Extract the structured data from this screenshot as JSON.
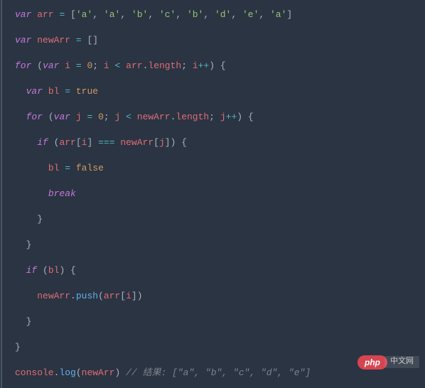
{
  "code": {
    "l1": {
      "kw": "var",
      "sp1": " ",
      "v": "arr",
      "sp2": " ",
      "eq": "=",
      "sp3": " ",
      "ob": "[",
      "s1": "'a'",
      "c1": ", ",
      "s2": "'a'",
      "c2": ", ",
      "s3": "'b'",
      "c3": ", ",
      "s4": "'c'",
      "c4": ", ",
      "s5": "'b'",
      "c5": ", ",
      "s6": "'d'",
      "c6": ", ",
      "s7": "'e'",
      "c7": ", ",
      "s8": "'a'",
      "cb": "]"
    },
    "l2": {
      "kw": "var",
      "sp1": " ",
      "v": "newArr",
      "sp2": " ",
      "eq": "=",
      "sp3": " ",
      "ob": "[",
      "cb": "]"
    },
    "l3": {
      "kw1": "for",
      "sp1": " ",
      "op": "(",
      "kw2": "var",
      "sp2": " ",
      "v": "i",
      "sp3": " ",
      "eq": "=",
      "sp4": " ",
      "n": "0",
      "sc1": "; ",
      "v2": "i",
      "sp5": " ",
      "lt": "<",
      "sp6": " ",
      "arr": "arr",
      "dot": ".",
      "len": "length",
      "sc2": "; ",
      "v3": "i",
      "inc": "++",
      "cp": ") {"
    },
    "l4": {
      "ind": "  ",
      "kw": "var",
      "sp1": " ",
      "v": "bl",
      "sp2": " ",
      "eq": "=",
      "sp3": " ",
      "b": "true"
    },
    "l5": {
      "ind": "  ",
      "kw1": "for",
      "sp1": " ",
      "op": "(",
      "kw2": "var",
      "sp2": " ",
      "v": "j",
      "sp3": " ",
      "eq": "=",
      "sp4": " ",
      "n": "0",
      "sc1": "; ",
      "v2": "j",
      "sp5": " ",
      "lt": "<",
      "sp6": " ",
      "na": "newArr",
      "dot": ".",
      "len": "length",
      "sc2": "; ",
      "v3": "j",
      "inc": "++",
      "cp": ") {"
    },
    "l6": {
      "ind": "    ",
      "kw": "if",
      "sp1": " ",
      "op": "(",
      "arr": "arr",
      "ob1": "[",
      "i": "i",
      "cb1": "]",
      "sp2": " ",
      "eqq": "===",
      "sp3": " ",
      "na": "newArr",
      "ob2": "[",
      "j": "j",
      "cb2": "]",
      "cp": ") {"
    },
    "l7": {
      "ind": "      ",
      "v": "bl",
      "sp1": " ",
      "eq": "=",
      "sp2": " ",
      "b": "false"
    },
    "l8": {
      "ind": "      ",
      "kw": "break"
    },
    "l9": {
      "ind": "    ",
      "br": "}"
    },
    "l10": {
      "ind": "  ",
      "br": "}"
    },
    "l11": {
      "ind": "  ",
      "kw": "if",
      "sp1": " ",
      "op": "(",
      "v": "bl",
      "cp": ") {"
    },
    "l12": {
      "ind": "    ",
      "na": "newArr",
      "dot": ".",
      "fn": "push",
      "op": "(",
      "arr": "arr",
      "ob": "[",
      "i": "i",
      "cb": "]",
      ")": ")"
    },
    "l13": {
      "ind": "  ",
      "br": "}"
    },
    "l14": {
      "br": "}"
    },
    "l15": {
      "con": "console",
      "dot": ".",
      "fn": "log",
      "op": "(",
      "na": "newArr",
      ")": ")",
      "sp": " ",
      "cm": "// 结果: [\"a\", \"b\", \"c\", \"d\", \"e\"]"
    }
  },
  "watermark": {
    "brand": "php",
    "suffix": "中文网"
  }
}
